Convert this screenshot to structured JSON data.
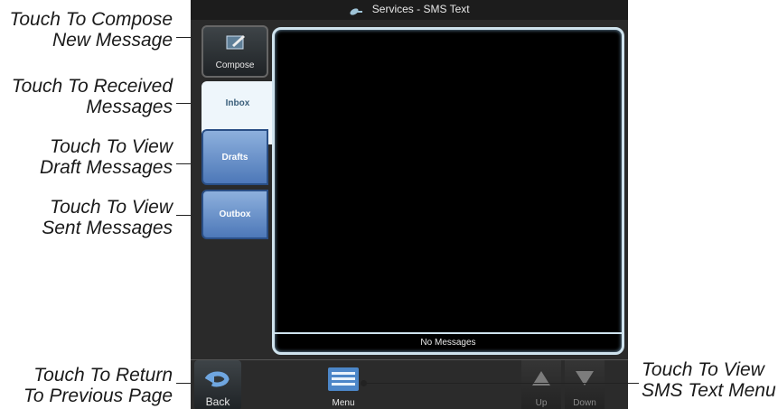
{
  "callouts": {
    "compose": [
      "Touch To Compose",
      "New Message"
    ],
    "inbox": [
      "Touch To Received",
      "Messages"
    ],
    "drafts": [
      "Touch To View",
      "Draft Messages"
    ],
    "outbox": [
      "Touch To View",
      "Sent Messages"
    ],
    "back": [
      "Touch To Return",
      "To Previous Page"
    ],
    "menu": [
      "Touch To View",
      "SMS Text Menu"
    ]
  },
  "screen": {
    "title": "Services - SMS Text",
    "title_icon": "satellite-icon",
    "tabs": {
      "compose": "Compose",
      "inbox": "Inbox",
      "drafts": "Drafts",
      "outbox": "Outbox"
    },
    "status": "No Messages",
    "bottom": {
      "back": "Back",
      "menu": "Menu",
      "up": "Up",
      "down": "Down"
    }
  },
  "colors": {
    "tab_blue": "#6f95cc",
    "active_tab": "#eef6fb",
    "pane_border": "#cfe3ee"
  }
}
